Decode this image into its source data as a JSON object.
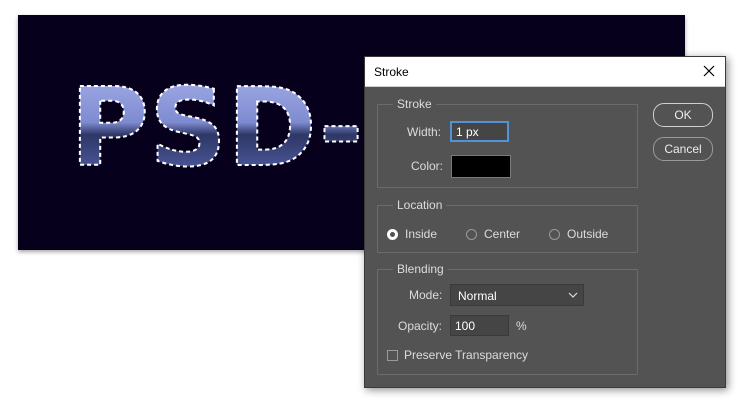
{
  "canvas": {
    "text": "PSD-v",
    "background_color": "#07001c",
    "text_fill_top": "#9aa4e0",
    "text_fill_bottom": "#3e4a86"
  },
  "dialog": {
    "title": "Stroke",
    "close_icon": "close-icon",
    "stroke_group": {
      "legend": "Stroke",
      "width_label": "Width:",
      "width_value": "1 px",
      "color_label": "Color:",
      "color_value": "#000000"
    },
    "location_group": {
      "legend": "Location",
      "options": [
        {
          "label": "Inside",
          "checked": true
        },
        {
          "label": "Center",
          "checked": false
        },
        {
          "label": "Outside",
          "checked": false
        }
      ]
    },
    "blending_group": {
      "legend": "Blending",
      "mode_label": "Mode:",
      "mode_value": "Normal",
      "opacity_label": "Opacity:",
      "opacity_value": "100",
      "opacity_unit": "%",
      "preserve_label": "Preserve Transparency",
      "preserve_checked": false
    },
    "ok_label": "OK",
    "cancel_label": "Cancel"
  }
}
